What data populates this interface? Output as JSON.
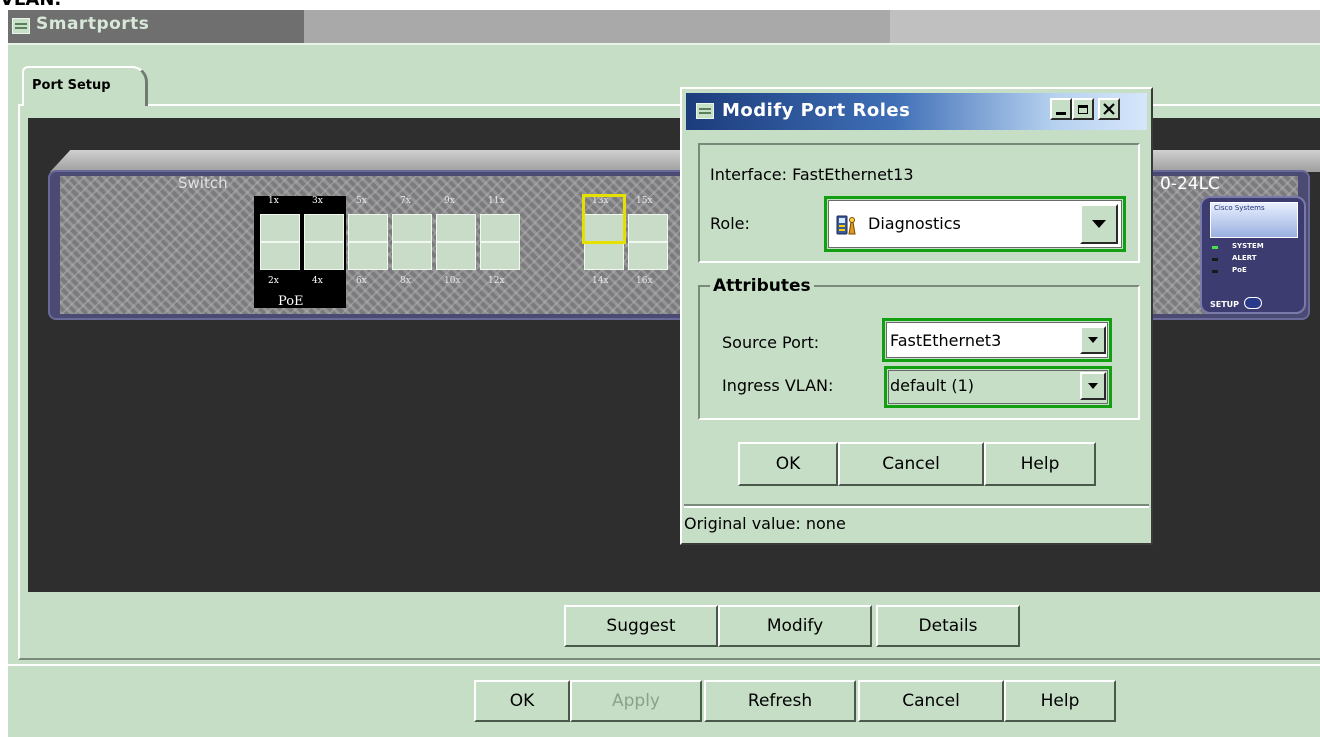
{
  "page_top_fragment": "VLAN.",
  "window": {
    "title": "Smartports"
  },
  "tabs": [
    {
      "label": "Port Setup"
    }
  ],
  "switch": {
    "label": "Switch",
    "model_suffix": "0-24LC",
    "top_port_labels": [
      "1x",
      "3x",
      "5x",
      "7x",
      "9x",
      "11x",
      "13x",
      "15x"
    ],
    "bottom_port_labels": [
      "2x",
      "4x",
      "6x",
      "8x",
      "10x",
      "12x",
      "14x",
      "16x"
    ],
    "poe_label": "PoE",
    "status_logo_text": "Cisco Systems",
    "status_items": [
      "SYSTEM",
      "ALERT",
      "PoE"
    ],
    "setup_label": "SETUP",
    "selected_port": "13x"
  },
  "panel_buttons": {
    "suggest": "Suggest",
    "modify": "Modify",
    "details": "Details"
  },
  "footer_buttons": {
    "ok": "OK",
    "apply": "Apply",
    "refresh": "Refresh",
    "cancel": "Cancel",
    "help": "Help"
  },
  "dialog": {
    "title": "Modify Port Roles",
    "interface_text": "Interface: FastEthernet13",
    "role_label": "Role:",
    "role_value": "Diagnostics",
    "attributes_title": "Attributes",
    "source_port_label": "Source Port:",
    "source_port_value": "FastEthernet3",
    "ingress_vlan_label": "Ingress VLAN:",
    "ingress_vlan_value": "default (1)",
    "buttons": {
      "ok": "OK",
      "cancel": "Cancel",
      "help": "Help"
    },
    "status_text": "Original value: none"
  },
  "colors": {
    "panel_bg": "#c6dec6",
    "highlight_border": "#12a012",
    "selected_port_border": "#e6e000",
    "workspace_bg": "#2e2e2e"
  }
}
